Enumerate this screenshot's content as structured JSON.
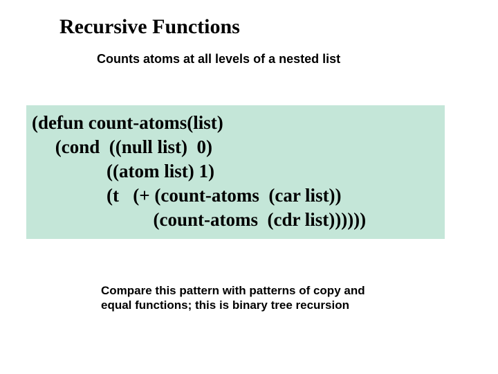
{
  "title": "Recursive Functions",
  "subtitle": "Counts atoms at all levels of a nested list",
  "code": {
    "l1": "(defun count-atoms(list)",
    "l2": "     (cond  ((null list)  0)",
    "l3": "                ((atom list) 1)",
    "l4": "                (t   (+ (count-atoms  (car list))",
    "l5": "                          (count-atoms  (cdr list))))))"
  },
  "note": "Compare this pattern with patterns of copy and equal functions; this is binary tree recursion"
}
